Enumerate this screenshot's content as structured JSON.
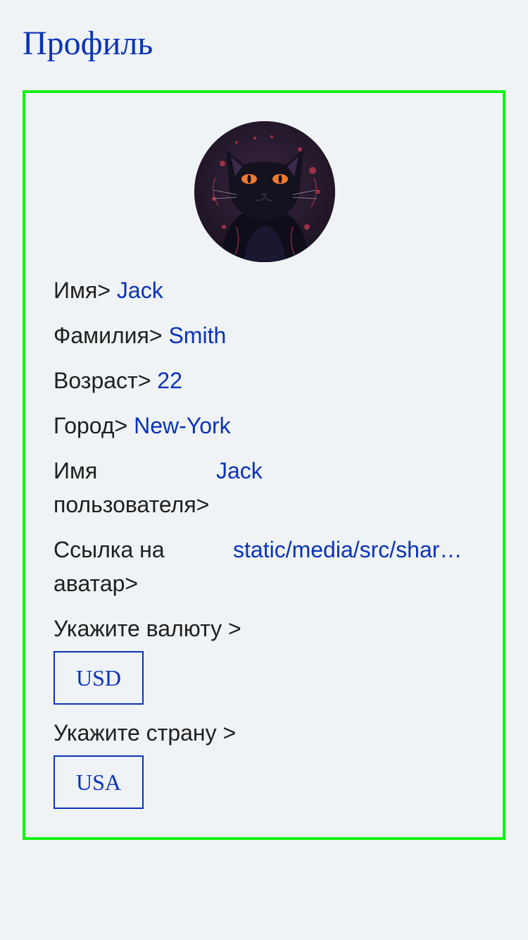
{
  "page": {
    "title": "Профиль"
  },
  "profile": {
    "first_name_label": "Имя>",
    "first_name": "Jack",
    "last_name_label": "Фамилия>",
    "last_name": "Smith",
    "age_label": "Возраст>",
    "age": "22",
    "city_label": "Город>",
    "city": "New-York",
    "username_label_line1": "Имя",
    "username_label_line2": "пользователя>",
    "username": "Jack",
    "avatar_link_label_line1": "Ссылка на",
    "avatar_link_label_line2": "аватар>",
    "avatar_link": "static/media/src/shared/avatar.png",
    "currency_label": "Укажите валюту >",
    "currency_selected": "USD",
    "country_label": "Укажите страну >",
    "country_selected": "USA"
  },
  "icons": {
    "avatar": "black-cat-avatar-icon"
  },
  "colors": {
    "accent": "#0a33b8",
    "card_border": "#13f213",
    "background": "#eff3f6",
    "text": "#1f1f1f"
  }
}
